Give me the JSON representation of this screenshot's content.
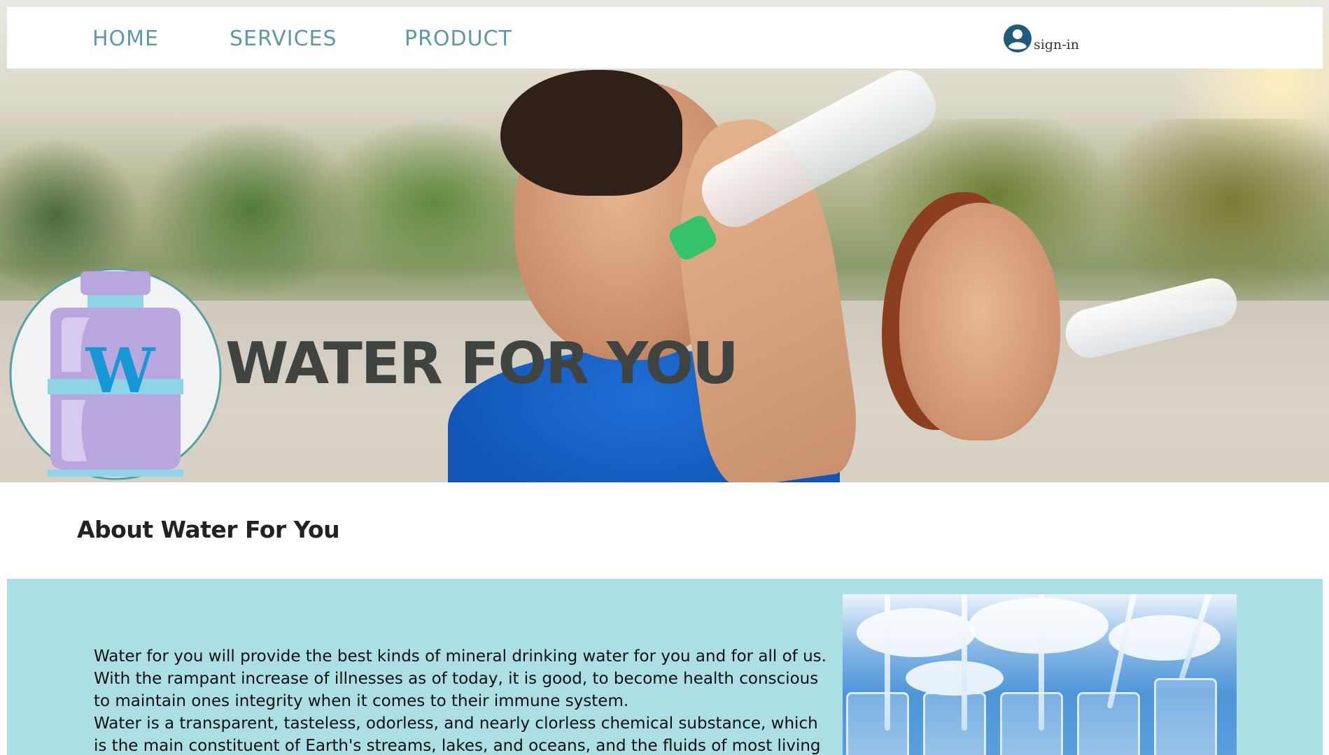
{
  "nav": {
    "home": "HOME",
    "services": "SERVICES",
    "product": "PRODUCT",
    "signin": "sign-in"
  },
  "hero": {
    "title": "WATER FOR YOU",
    "logo_letter": "W"
  },
  "about": {
    "heading": "About Water For You",
    "paragraphs": [
      "Water for you will provide the best kinds of mineral drinking water for you and for all of us. With the rampant increase of illnesses as of today, it is good, to become health conscious to maintain ones integrity when it comes to their immune system.",
      "Water is a transparent, tasteless, odorless, and nearly clorless chemical substance, which is the main constituent of Earth's streams, lakes, and oceans, and the fluids of most living"
    ]
  },
  "colors": {
    "nav_text": "#5e9aa4",
    "content_bg": "#acdfe3",
    "title_text": "#3f4441",
    "logo_purple": "#b8a6df",
    "logo_blue": "#1798d6",
    "signin_icon": "#1f5a7c"
  },
  "icons": {
    "signin": "user-circle-icon",
    "logo": "water-bottle-logo"
  }
}
